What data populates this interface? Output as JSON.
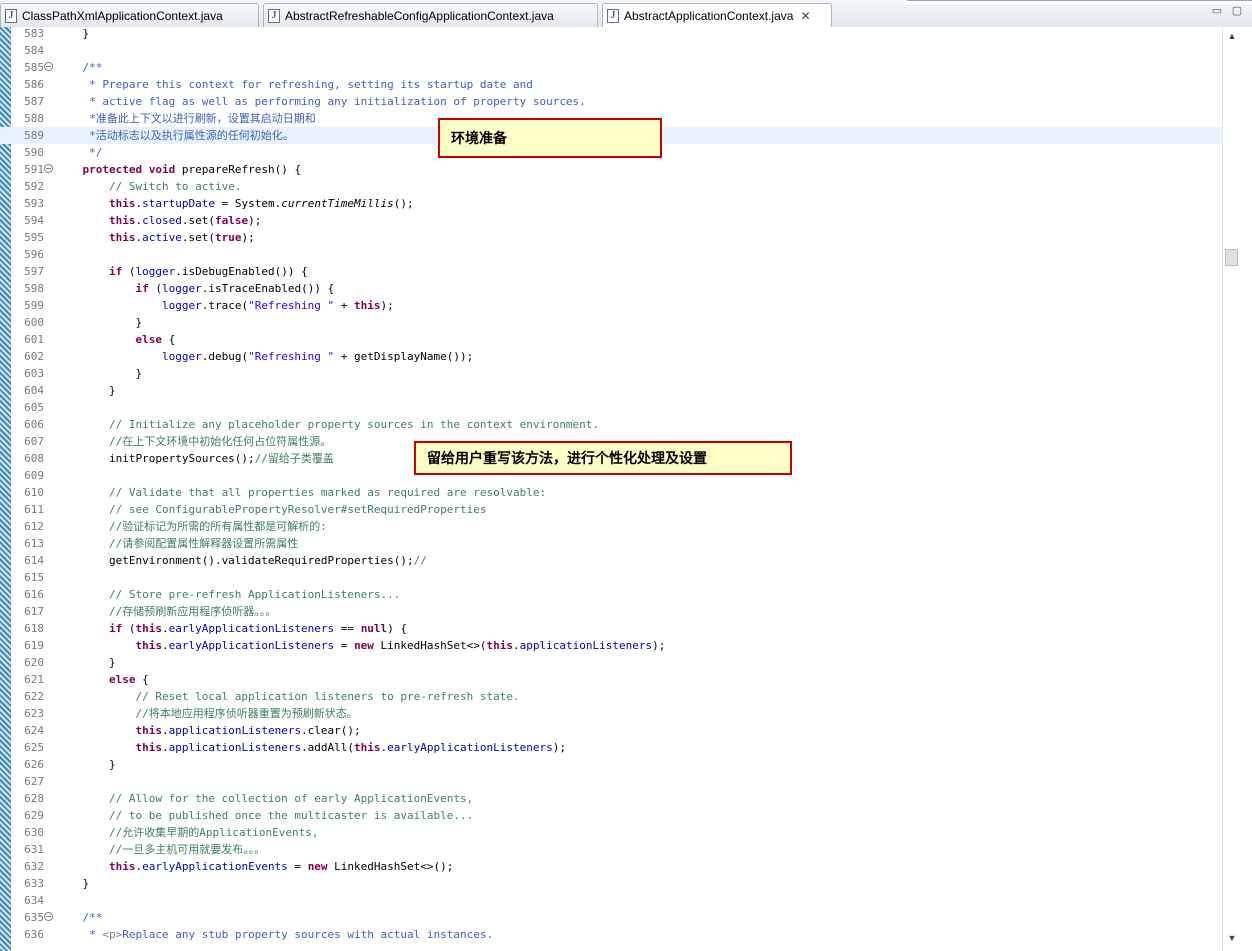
{
  "tabs": [
    {
      "label": "ClassPathXmlApplicationContext.java",
      "active": false
    },
    {
      "label": "AbstractRefreshableConfigApplicationContext.java",
      "active": false
    },
    {
      "label": "AbstractApplicationContext.java",
      "active": true
    }
  ],
  "tab_close_glyph": "✕",
  "window_buttons": {
    "minimize": "▭",
    "maximize": "▢"
  },
  "callouts": {
    "env_prepare": "环境准备",
    "user_override": "留给用户重写该方法，进行个性化处理及设置"
  },
  "scrollbar": {
    "up": "▲",
    "down": "▼"
  },
  "colors": {
    "comment": "#3f7f5f",
    "javadoc": "#3f5fbf",
    "keyword": "#7f0055",
    "field": "#0000c0",
    "string": "#2a00ff",
    "current_line": "#e8f2fe",
    "callout_border": "#c80000",
    "callout_fill": "#ffffc8"
  },
  "editor_lines": [
    {
      "n": "583",
      "p": [
        {
          "t": "    }"
        }
      ]
    },
    {
      "n": "584",
      "p": []
    },
    {
      "n": "585",
      "fold": true,
      "p": [
        {
          "t": "    /**",
          "c": "doc"
        }
      ]
    },
    {
      "n": "586",
      "p": [
        {
          "t": "     * Prepare this context for refreshing, setting its startup date and",
          "c": "doc"
        }
      ]
    },
    {
      "n": "587",
      "p": [
        {
          "t": "     * active flag as well as performing any initialization of property sources.",
          "c": "doc"
        }
      ]
    },
    {
      "n": "588",
      "p": [
        {
          "t": "     *准备此上下文以进行刷新，设置其启动日期和",
          "c": "doc"
        }
      ]
    },
    {
      "n": "589",
      "hl": true,
      "p": [
        {
          "t": "     *活动标志以及执行属性源的任何初始化。",
          "c": "doc"
        }
      ]
    },
    {
      "n": "590",
      "p": [
        {
          "t": "     */",
          "c": "doc"
        }
      ]
    },
    {
      "n": "591",
      "fold": true,
      "p": [
        {
          "t": "    "
        },
        {
          "t": "protected",
          "c": "kw"
        },
        {
          "t": " "
        },
        {
          "t": "void",
          "c": "kw"
        },
        {
          "t": " prepareRefresh() {"
        }
      ]
    },
    {
      "n": "592",
      "p": [
        {
          "t": "        // Switch to active.",
          "c": "comment"
        }
      ]
    },
    {
      "n": "593",
      "p": [
        {
          "t": "        "
        },
        {
          "t": "this",
          "c": "kw"
        },
        {
          "t": "."
        },
        {
          "t": "startupDate",
          "c": "field"
        },
        {
          "t": " = System."
        },
        {
          "t": "currentTimeMillis",
          "c": "static"
        },
        {
          "t": "();"
        }
      ]
    },
    {
      "n": "594",
      "p": [
        {
          "t": "        "
        },
        {
          "t": "this",
          "c": "kw"
        },
        {
          "t": "."
        },
        {
          "t": "closed",
          "c": "field"
        },
        {
          "t": ".set("
        },
        {
          "t": "false",
          "c": "kw"
        },
        {
          "t": ");"
        }
      ]
    },
    {
      "n": "595",
      "p": [
        {
          "t": "        "
        },
        {
          "t": "this",
          "c": "kw"
        },
        {
          "t": "."
        },
        {
          "t": "active",
          "c": "field"
        },
        {
          "t": ".set("
        },
        {
          "t": "true",
          "c": "kw"
        },
        {
          "t": ");"
        }
      ]
    },
    {
      "n": "596",
      "p": []
    },
    {
      "n": "597",
      "p": [
        {
          "t": "        "
        },
        {
          "t": "if",
          "c": "kw"
        },
        {
          "t": " ("
        },
        {
          "t": "logger",
          "c": "field"
        },
        {
          "t": ".isDebugEnabled()) {"
        }
      ]
    },
    {
      "n": "598",
      "p": [
        {
          "t": "            "
        },
        {
          "t": "if",
          "c": "kw"
        },
        {
          "t": " ("
        },
        {
          "t": "logger",
          "c": "field"
        },
        {
          "t": ".isTraceEnabled()) {"
        }
      ]
    },
    {
      "n": "599",
      "p": [
        {
          "t": "                "
        },
        {
          "t": "logger",
          "c": "field"
        },
        {
          "t": ".trace("
        },
        {
          "t": "\"Refreshing \"",
          "c": "str"
        },
        {
          "t": " + "
        },
        {
          "t": "this",
          "c": "kw"
        },
        {
          "t": ");"
        }
      ]
    },
    {
      "n": "600",
      "p": [
        {
          "t": "            }"
        }
      ]
    },
    {
      "n": "601",
      "p": [
        {
          "t": "            "
        },
        {
          "t": "else",
          "c": "kw"
        },
        {
          "t": " {"
        }
      ]
    },
    {
      "n": "602",
      "p": [
        {
          "t": "                "
        },
        {
          "t": "logger",
          "c": "field"
        },
        {
          "t": ".debug("
        },
        {
          "t": "\"Refreshing \"",
          "c": "str"
        },
        {
          "t": " + getDisplayName());"
        }
      ]
    },
    {
      "n": "603",
      "p": [
        {
          "t": "            }"
        }
      ]
    },
    {
      "n": "604",
      "p": [
        {
          "t": "        }"
        }
      ]
    },
    {
      "n": "605",
      "p": []
    },
    {
      "n": "606",
      "p": [
        {
          "t": "        // Initialize any placeholder property sources in the context environment.",
          "c": "comment"
        }
      ]
    },
    {
      "n": "607",
      "p": [
        {
          "t": "        //在上下文环境中初始化任何占位符属性源。",
          "c": "comment"
        }
      ]
    },
    {
      "n": "608",
      "p": [
        {
          "t": "        initPropertySources();"
        },
        {
          "t": "//留给子类覆盖",
          "c": "comment"
        }
      ]
    },
    {
      "n": "609",
      "p": []
    },
    {
      "n": "610",
      "p": [
        {
          "t": "        // Validate that all properties marked as required are resolvable:",
          "c": "comment"
        }
      ]
    },
    {
      "n": "611",
      "p": [
        {
          "t": "        // see ConfigurablePropertyResolver#setRequiredProperties",
          "c": "comment"
        }
      ]
    },
    {
      "n": "612",
      "p": [
        {
          "t": "        //验证标记为所需的所有属性都是可解析的:",
          "c": "comment"
        }
      ]
    },
    {
      "n": "613",
      "p": [
        {
          "t": "        //请参阅配置属性解释器设置所需属性",
          "c": "comment"
        }
      ]
    },
    {
      "n": "614",
      "p": [
        {
          "t": "        getEnvironment().validateRequiredProperties();"
        },
        {
          "t": "//",
          "c": "comment"
        }
      ]
    },
    {
      "n": "615",
      "p": []
    },
    {
      "n": "616",
      "p": [
        {
          "t": "        // Store pre-refresh ApplicationListeners...",
          "c": "comment"
        }
      ]
    },
    {
      "n": "617",
      "p": [
        {
          "t": "        //存储预刷新应用程序侦听器。。。",
          "c": "comment"
        }
      ]
    },
    {
      "n": "618",
      "p": [
        {
          "t": "        "
        },
        {
          "t": "if",
          "c": "kw"
        },
        {
          "t": " ("
        },
        {
          "t": "this",
          "c": "kw"
        },
        {
          "t": "."
        },
        {
          "t": "earlyApplicationListeners",
          "c": "field"
        },
        {
          "t": " == "
        },
        {
          "t": "null",
          "c": "kw"
        },
        {
          "t": ") {"
        }
      ]
    },
    {
      "n": "619",
      "p": [
        {
          "t": "            "
        },
        {
          "t": "this",
          "c": "kw"
        },
        {
          "t": "."
        },
        {
          "t": "earlyApplicationListeners",
          "c": "field"
        },
        {
          "t": " = "
        },
        {
          "t": "new",
          "c": "kw"
        },
        {
          "t": " LinkedHashSet<>("
        },
        {
          "t": "this",
          "c": "kw"
        },
        {
          "t": "."
        },
        {
          "t": "applicationListeners",
          "c": "field"
        },
        {
          "t": ");"
        }
      ]
    },
    {
      "n": "620",
      "p": [
        {
          "t": "        }"
        }
      ]
    },
    {
      "n": "621",
      "p": [
        {
          "t": "        "
        },
        {
          "t": "else",
          "c": "kw"
        },
        {
          "t": " {"
        }
      ]
    },
    {
      "n": "622",
      "p": [
        {
          "t": "            // Reset local application listeners to pre-refresh state.",
          "c": "comment"
        }
      ]
    },
    {
      "n": "623",
      "p": [
        {
          "t": "            //将本地应用程序侦听器重置为预刷新状态。",
          "c": "comment"
        }
      ]
    },
    {
      "n": "624",
      "p": [
        {
          "t": "            "
        },
        {
          "t": "this",
          "c": "kw"
        },
        {
          "t": "."
        },
        {
          "t": "applicationListeners",
          "c": "field"
        },
        {
          "t": ".clear();"
        }
      ]
    },
    {
      "n": "625",
      "p": [
        {
          "t": "            "
        },
        {
          "t": "this",
          "c": "kw"
        },
        {
          "t": "."
        },
        {
          "t": "applicationListeners",
          "c": "field"
        },
        {
          "t": ".addAll("
        },
        {
          "t": "this",
          "c": "kw"
        },
        {
          "t": "."
        },
        {
          "t": "earlyApplicationListeners",
          "c": "field"
        },
        {
          "t": ");"
        }
      ]
    },
    {
      "n": "626",
      "p": [
        {
          "t": "        }"
        }
      ]
    },
    {
      "n": "627",
      "p": []
    },
    {
      "n": "628",
      "p": [
        {
          "t": "        // Allow for the collection of early ApplicationEvents,",
          "c": "comment"
        }
      ]
    },
    {
      "n": "629",
      "p": [
        {
          "t": "        // to be published once the multicaster is available...",
          "c": "comment"
        }
      ]
    },
    {
      "n": "630",
      "p": [
        {
          "t": "        //允许收集早期的ApplicationEvents,",
          "c": "comment"
        }
      ]
    },
    {
      "n": "631",
      "p": [
        {
          "t": "        //一旦多主机可用就要发布。。。",
          "c": "comment"
        }
      ]
    },
    {
      "n": "632",
      "p": [
        {
          "t": "        "
        },
        {
          "t": "this",
          "c": "kw"
        },
        {
          "t": "."
        },
        {
          "t": "earlyApplicationEvents",
          "c": "field"
        },
        {
          "t": " = "
        },
        {
          "t": "new",
          "c": "kw"
        },
        {
          "t": " LinkedHashSet<>();"
        }
      ]
    },
    {
      "n": "633",
      "p": [
        {
          "t": "    }"
        }
      ]
    },
    {
      "n": "634",
      "p": []
    },
    {
      "n": "635",
      "fold": true,
      "p": [
        {
          "t": "    /**",
          "c": "doc"
        }
      ]
    },
    {
      "n": "636",
      "p": [
        {
          "t": "     * ",
          "c": "doc"
        },
        {
          "t": "<p>",
          "c": "tag"
        },
        {
          "t": "Replace any stub property sources with actual instances.",
          "c": "doc"
        }
      ]
    }
  ]
}
